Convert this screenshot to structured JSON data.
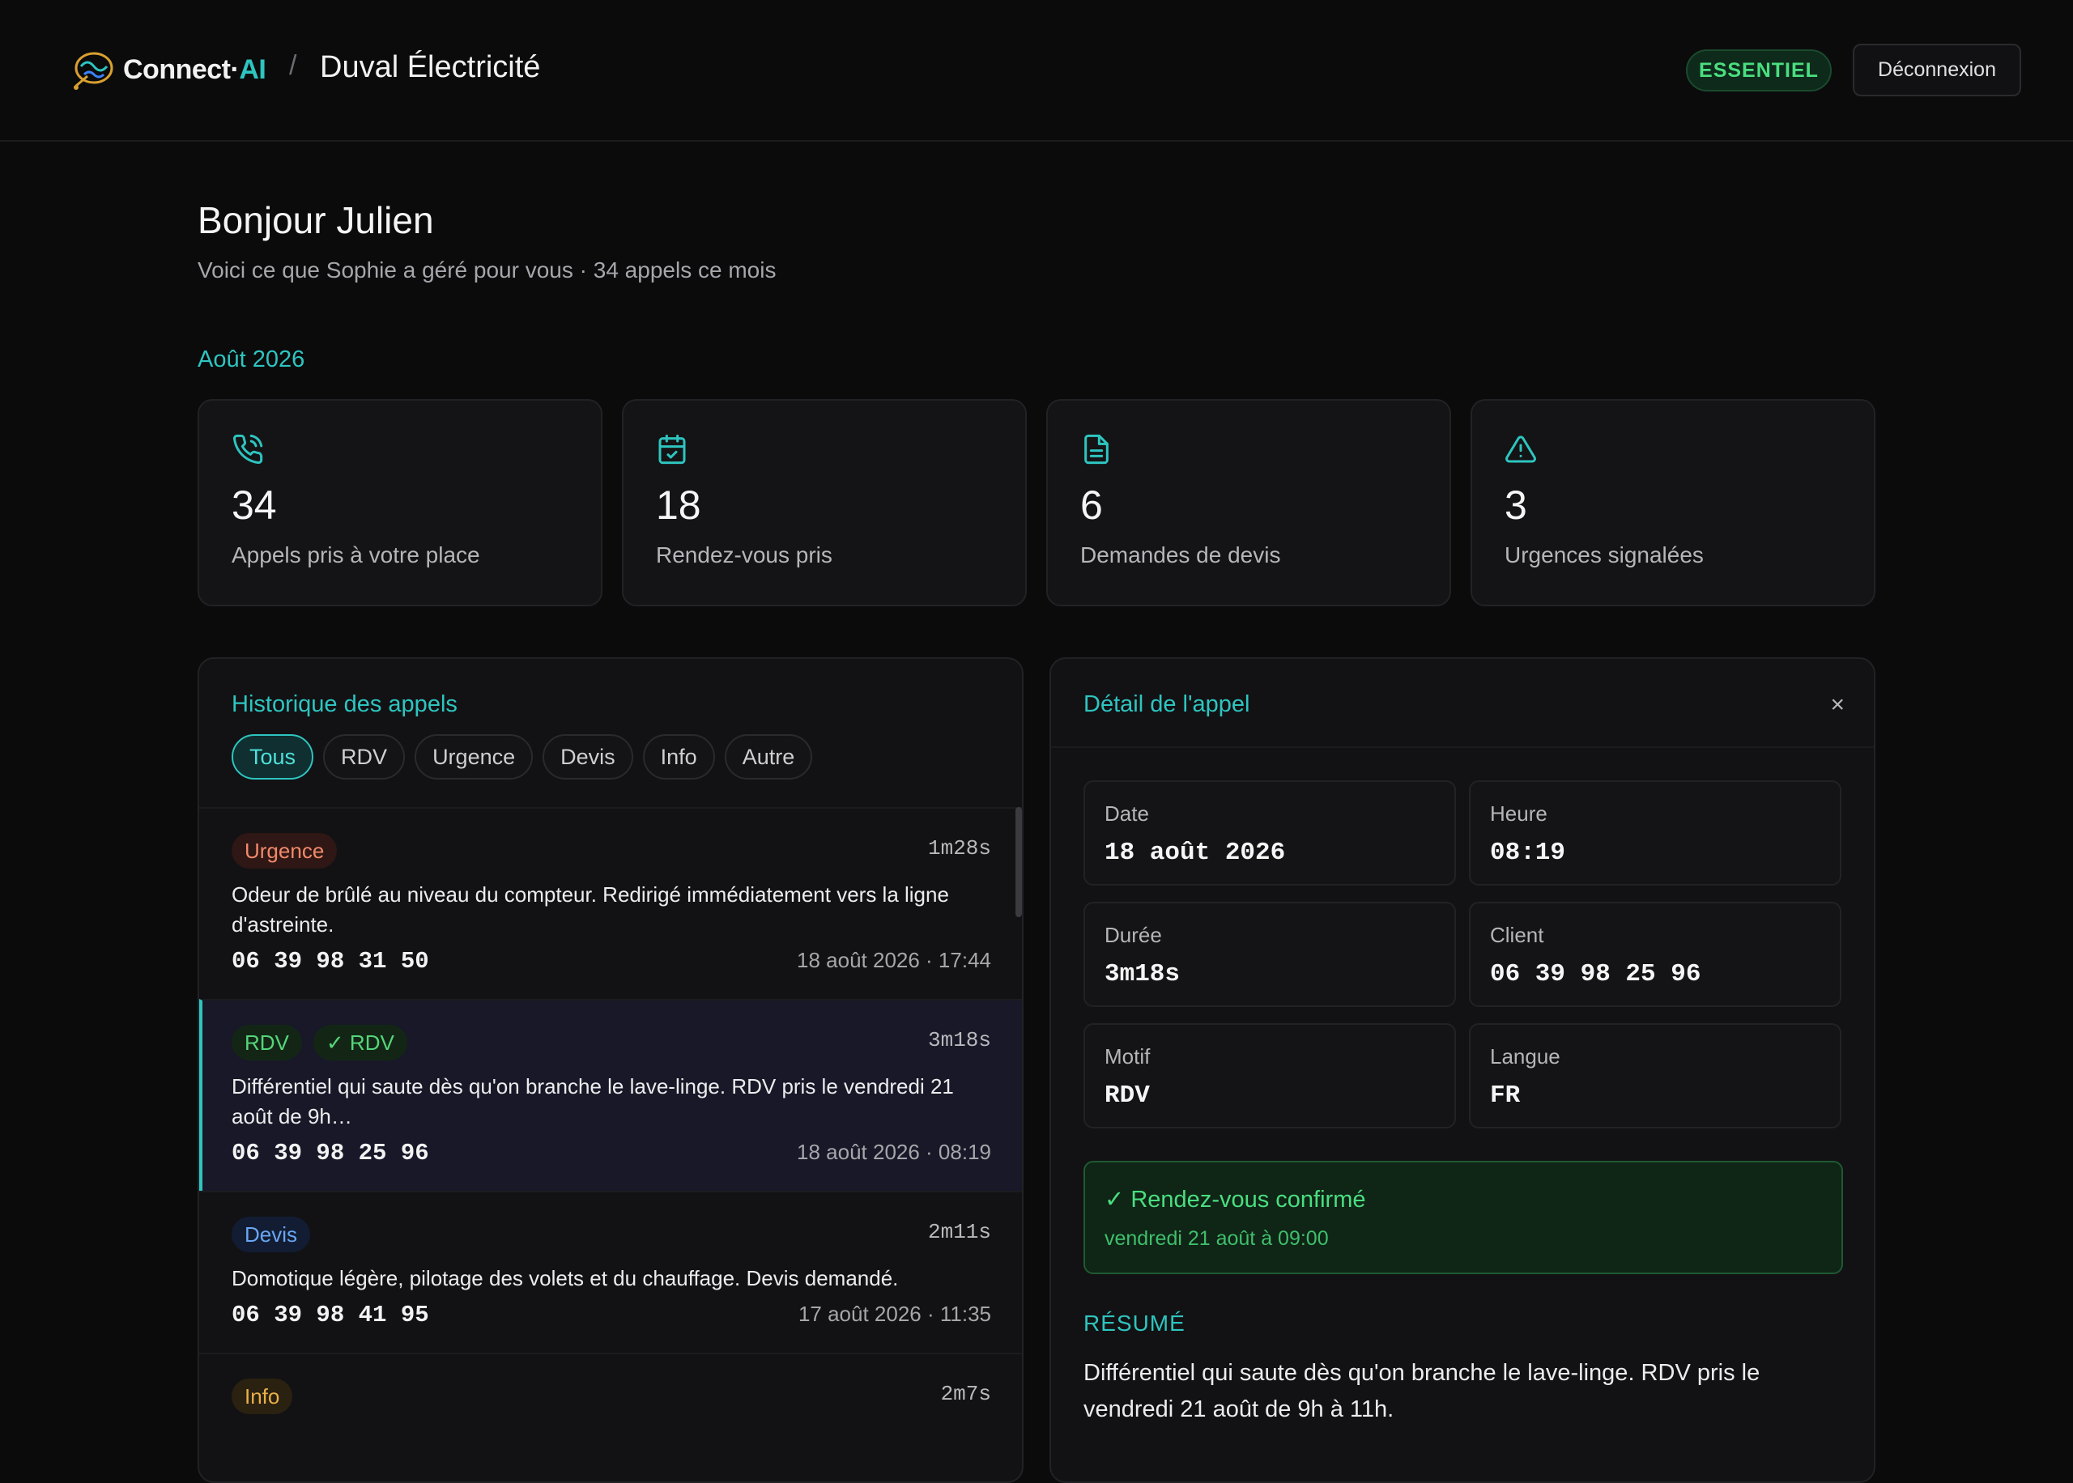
{
  "header": {
    "brand_main": "Connect·",
    "brand_accent": "AI",
    "separator": "/",
    "company": "Duval Électricité",
    "plan": "ESSENTIEL",
    "logout": "Déconnexion"
  },
  "greeting": {
    "title": "Bonjour Julien",
    "subtitle": "Voici ce que Sophie a géré pour vous · 34 appels ce mois",
    "month": "Août 2026"
  },
  "stats": [
    {
      "icon": "phone-call-icon",
      "value": "34",
      "label": "Appels pris à votre place"
    },
    {
      "icon": "calendar-check-icon",
      "value": "18",
      "label": "Rendez-vous pris"
    },
    {
      "icon": "document-icon",
      "value": "6",
      "label": "Demandes de devis"
    },
    {
      "icon": "warning-icon",
      "value": "3",
      "label": "Urgences signalées"
    }
  ],
  "history": {
    "title": "Historique des appels",
    "filters": [
      "Tous",
      "RDV",
      "Urgence",
      "Devis",
      "Info",
      "Autre"
    ],
    "active_filter": "Tous",
    "calls": [
      {
        "tags": [
          "Urgence"
        ],
        "duration": "1m28s",
        "summary": "Odeur de brûlé au niveau du compteur. Redirigé immédiatement vers la ligne d'astreinte.",
        "phone": "06 39 98 31 50",
        "when": "18 août 2026 · 17:44"
      },
      {
        "tags": [
          "RDV",
          "✓ RDV"
        ],
        "duration": "3m18s",
        "summary": "Différentiel qui saute dès qu'on branche le lave-linge. RDV pris le vendredi 21 août de 9h…",
        "phone": "06 39 98 25 96",
        "when": "18 août 2026 · 08:19"
      },
      {
        "tags": [
          "Devis"
        ],
        "duration": "2m11s",
        "summary": "Domotique légère, pilotage des volets et du chauffage. Devis demandé.",
        "phone": "06 39 98 41 95",
        "when": "17 août 2026 · 11:35"
      },
      {
        "tags": [
          "Info"
        ],
        "duration": "2m7s"
      }
    ]
  },
  "detail": {
    "title": "Détail de l'appel",
    "close": "×",
    "fields": {
      "date_label": "Date",
      "date": "18 août 2026",
      "time_label": "Heure",
      "time": "08:19",
      "duration_label": "Durée",
      "duration": "3m18s",
      "client_label": "Client",
      "client": "06 39 98 25 96",
      "reason_label": "Motif",
      "reason": "RDV",
      "lang_label": "Langue",
      "lang": "FR"
    },
    "confirm_title": "✓ Rendez-vous confirmé",
    "confirm_sub": "vendredi 21 août à 09:00",
    "resume_label": "RÉSUMÉ",
    "resume_text": "Différentiel qui saute dès qu'on branche le lave-linge. RDV pris le vendredi 21 août de 9h à 11h."
  },
  "colors": {
    "accent": "#2ec5c0",
    "urgent": "#f08a6a",
    "rdv": "#55d67a",
    "devis": "#6aa6f2",
    "info": "#e9b04a"
  }
}
